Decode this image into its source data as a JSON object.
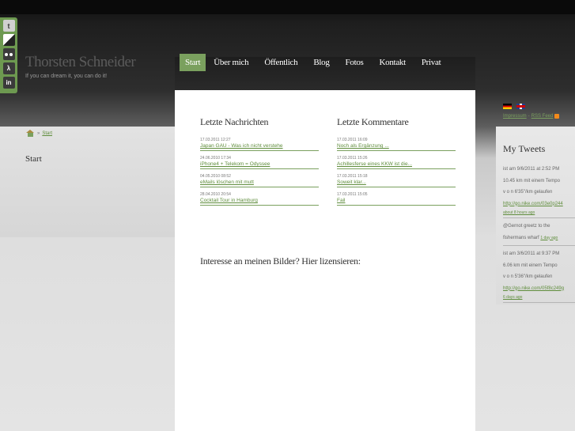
{
  "site": {
    "title": "Thorsten Schneider",
    "tagline": "If you can dream it, you can do it!"
  },
  "social": [
    {
      "name": "twitter",
      "glyph": "t"
    },
    {
      "name": "delicious",
      "glyph": ""
    },
    {
      "name": "flickr",
      "glyph": ""
    },
    {
      "name": "lastfm",
      "glyph": "λ"
    },
    {
      "name": "linkedin",
      "glyph": "in"
    }
  ],
  "nav": {
    "items": [
      "Start",
      "Über mich",
      "Öffentlich",
      "Blog",
      "Fotos",
      "Kontakt",
      "Privat"
    ],
    "active": "Start"
  },
  "breadcrumb": {
    "home": "Start"
  },
  "page": {
    "heading": "Start"
  },
  "news": {
    "title": "Letzte Nachrichten",
    "items": [
      {
        "date": "17.03.2011 12:27",
        "title": "Japan GAU - Was ich nicht verstehe"
      },
      {
        "date": "24.06.2010 17:34",
        "title": "iPhone4 + Telekom = Odyssee"
      },
      {
        "date": "04.05.2010 08:52",
        "title": "eMails löschen mit mutt"
      },
      {
        "date": "28.04.2010 20:54",
        "title": "Cocktail Tour in Hamburg"
      }
    ]
  },
  "comments": {
    "title": "Letzte Kommentare",
    "items": [
      {
        "date": "17.03.2011 16:09",
        "title": "Noch als Ergänzung ..."
      },
      {
        "date": "17.03.2011 15:26",
        "title": "Achillesferse eines KKW ist die..."
      },
      {
        "date": "17.03.2011 15:18",
        "title": "Soweit klar..."
      },
      {
        "date": "17.03.2011 15:05",
        "title": "Fail"
      }
    ]
  },
  "license": {
    "text": "Interesse an meinen Bilder? Hier lizensieren:"
  },
  "sidebar": {
    "impressum": "Impressum",
    "separator": "-",
    "rss": "RSS Feed",
    "tweets_title": "My Tweets",
    "tweets": [
      {
        "lines": [
          "ist am 9/6/2011 at 2:52 PM",
          "10.45 km mit einem Tempo",
          "v o n 6'35\"/km gelaufen"
        ],
        "link": "http://go.nike.com/03e0p244",
        "time": "about 8 hours ago"
      },
      {
        "lines": [
          "@Gernot greetz to the",
          "fishermans wharf"
        ],
        "link": "",
        "time": "1 day ago"
      },
      {
        "lines": [
          "ist am 3/6/2011 at 9:37 PM",
          "6.06 km mit einem Tempo",
          "v o n 5'36\"/km gelaufen"
        ],
        "link": "http://go.nike.com/05f8c249g",
        "time": "6 days ago"
      }
    ]
  },
  "colors": {
    "accent": "#7aa05e",
    "link": "#5f8d3c",
    "social_bar": "#6d9950"
  }
}
